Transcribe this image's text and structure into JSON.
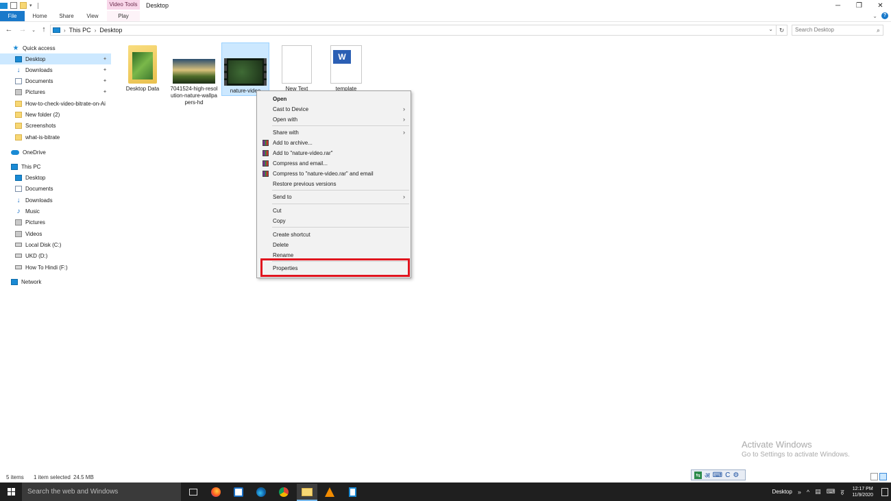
{
  "window": {
    "contextual_tab_group": "Video Tools",
    "title": "Desktop",
    "controls": [
      "─",
      "❐",
      "✕"
    ]
  },
  "ribbon": {
    "tabs": [
      "File",
      "Home",
      "Share",
      "View",
      "Play"
    ]
  },
  "address": {
    "crumbs": [
      "This PC",
      "Desktop"
    ],
    "search_placeholder": "Search Desktop"
  },
  "navpane": {
    "quick_access": "Quick access",
    "quick_items": [
      "Desktop",
      "Downloads",
      "Documents",
      "Pictures",
      "How-to-check-video-bitrate-on-Ai",
      "New folder (2)",
      "Screenshots",
      "what-is-bitrate"
    ],
    "onedrive": "OneDrive",
    "this_pc": "This PC",
    "pc_items": [
      "Desktop",
      "Documents",
      "Downloads",
      "Music",
      "Pictures",
      "Videos",
      "Local Disk (C:)",
      "UKD (D:)",
      "How To Hindi (F:)"
    ],
    "network": "Network"
  },
  "files": [
    {
      "name": "Desktop Data"
    },
    {
      "name": "7041524-high-resolution-nature-wallpapers-hd"
    },
    {
      "name": "nature-video"
    },
    {
      "name": "New Text"
    },
    {
      "name": "template"
    }
  ],
  "context_menu": {
    "items": [
      "Open",
      "Cast to Device",
      "Open with",
      "Share with",
      "Add to archive...",
      "Add to \"nature-video.rar\"",
      "Compress and email...",
      "Compress to \"nature-video.rar\" and email",
      "Restore previous versions",
      "Send to",
      "Cut",
      "Copy",
      "Create shortcut",
      "Delete",
      "Rename",
      "Properties"
    ],
    "highlighted": "Properties"
  },
  "status": {
    "items_count": "5 items",
    "selected": "1 item selected",
    "size": "24.5 MB"
  },
  "watermark": {
    "line1": "Activate Windows",
    "line2": "Go to Settings to activate Windows."
  },
  "taskbar": {
    "search_placeholder": "Search the web and Windows",
    "desktop_label": "Desktop",
    "time": "12:17 PM",
    "date": "11/9/2020"
  },
  "colors": {
    "accent": "#1979ca",
    "selection": "#cce8ff",
    "highlight_box": "#e0141e"
  }
}
